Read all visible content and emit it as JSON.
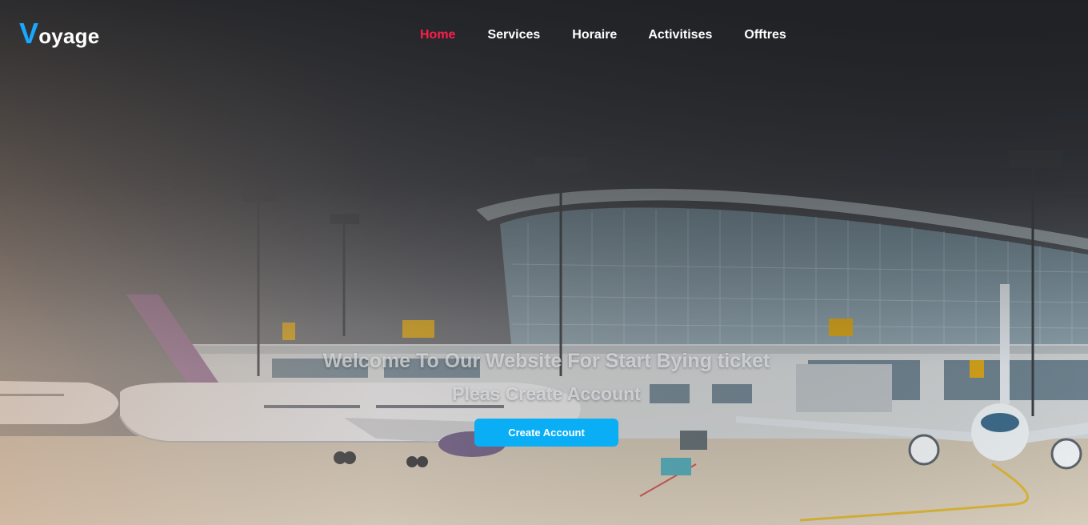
{
  "brand": {
    "first_letter": "V",
    "rest": "oyage",
    "accent_color": "#1aa7ff"
  },
  "nav": {
    "active_color": "#ff1e4a",
    "items": [
      {
        "label": "Home",
        "active": true
      },
      {
        "label": "Services",
        "active": false
      },
      {
        "label": "Horaire",
        "active": false
      },
      {
        "label": "Activitises",
        "active": false
      },
      {
        "label": "Offtres",
        "active": false
      }
    ]
  },
  "hero": {
    "headline_line1": "Welcome To Our Website For Start Bying ticket",
    "headline_line2": "Pleas Create Account",
    "cta_label": "Create Account",
    "cta_color": "#0aaef5",
    "background": "airport-terminal-photo"
  }
}
